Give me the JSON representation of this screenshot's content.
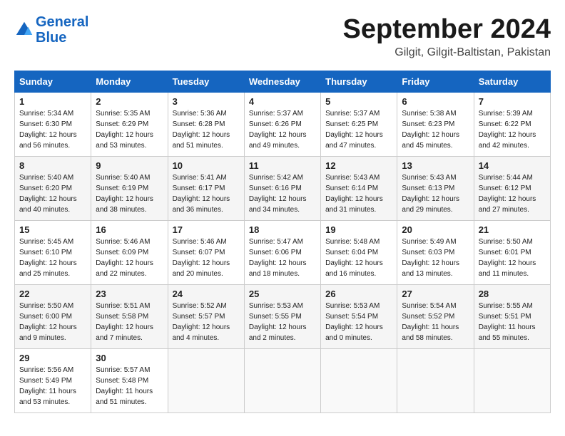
{
  "header": {
    "logo_line1": "General",
    "logo_line2": "Blue",
    "month": "September 2024",
    "location": "Gilgit, Gilgit-Baltistan, Pakistan"
  },
  "days_of_week": [
    "Sunday",
    "Monday",
    "Tuesday",
    "Wednesday",
    "Thursday",
    "Friday",
    "Saturday"
  ],
  "weeks": [
    [
      {
        "day": "1",
        "info": "Sunrise: 5:34 AM\nSunset: 6:30 PM\nDaylight: 12 hours\nand 56 minutes."
      },
      {
        "day": "2",
        "info": "Sunrise: 5:35 AM\nSunset: 6:29 PM\nDaylight: 12 hours\nand 53 minutes."
      },
      {
        "day": "3",
        "info": "Sunrise: 5:36 AM\nSunset: 6:28 PM\nDaylight: 12 hours\nand 51 minutes."
      },
      {
        "day": "4",
        "info": "Sunrise: 5:37 AM\nSunset: 6:26 PM\nDaylight: 12 hours\nand 49 minutes."
      },
      {
        "day": "5",
        "info": "Sunrise: 5:37 AM\nSunset: 6:25 PM\nDaylight: 12 hours\nand 47 minutes."
      },
      {
        "day": "6",
        "info": "Sunrise: 5:38 AM\nSunset: 6:23 PM\nDaylight: 12 hours\nand 45 minutes."
      },
      {
        "day": "7",
        "info": "Sunrise: 5:39 AM\nSunset: 6:22 PM\nDaylight: 12 hours\nand 42 minutes."
      }
    ],
    [
      {
        "day": "8",
        "info": "Sunrise: 5:40 AM\nSunset: 6:20 PM\nDaylight: 12 hours\nand 40 minutes."
      },
      {
        "day": "9",
        "info": "Sunrise: 5:40 AM\nSunset: 6:19 PM\nDaylight: 12 hours\nand 38 minutes."
      },
      {
        "day": "10",
        "info": "Sunrise: 5:41 AM\nSunset: 6:17 PM\nDaylight: 12 hours\nand 36 minutes."
      },
      {
        "day": "11",
        "info": "Sunrise: 5:42 AM\nSunset: 6:16 PM\nDaylight: 12 hours\nand 34 minutes."
      },
      {
        "day": "12",
        "info": "Sunrise: 5:43 AM\nSunset: 6:14 PM\nDaylight: 12 hours\nand 31 minutes."
      },
      {
        "day": "13",
        "info": "Sunrise: 5:43 AM\nSunset: 6:13 PM\nDaylight: 12 hours\nand 29 minutes."
      },
      {
        "day": "14",
        "info": "Sunrise: 5:44 AM\nSunset: 6:12 PM\nDaylight: 12 hours\nand 27 minutes."
      }
    ],
    [
      {
        "day": "15",
        "info": "Sunrise: 5:45 AM\nSunset: 6:10 PM\nDaylight: 12 hours\nand 25 minutes."
      },
      {
        "day": "16",
        "info": "Sunrise: 5:46 AM\nSunset: 6:09 PM\nDaylight: 12 hours\nand 22 minutes."
      },
      {
        "day": "17",
        "info": "Sunrise: 5:46 AM\nSunset: 6:07 PM\nDaylight: 12 hours\nand 20 minutes."
      },
      {
        "day": "18",
        "info": "Sunrise: 5:47 AM\nSunset: 6:06 PM\nDaylight: 12 hours\nand 18 minutes."
      },
      {
        "day": "19",
        "info": "Sunrise: 5:48 AM\nSunset: 6:04 PM\nDaylight: 12 hours\nand 16 minutes."
      },
      {
        "day": "20",
        "info": "Sunrise: 5:49 AM\nSunset: 6:03 PM\nDaylight: 12 hours\nand 13 minutes."
      },
      {
        "day": "21",
        "info": "Sunrise: 5:50 AM\nSunset: 6:01 PM\nDaylight: 12 hours\nand 11 minutes."
      }
    ],
    [
      {
        "day": "22",
        "info": "Sunrise: 5:50 AM\nSunset: 6:00 PM\nDaylight: 12 hours\nand 9 minutes."
      },
      {
        "day": "23",
        "info": "Sunrise: 5:51 AM\nSunset: 5:58 PM\nDaylight: 12 hours\nand 7 minutes."
      },
      {
        "day": "24",
        "info": "Sunrise: 5:52 AM\nSunset: 5:57 PM\nDaylight: 12 hours\nand 4 minutes."
      },
      {
        "day": "25",
        "info": "Sunrise: 5:53 AM\nSunset: 5:55 PM\nDaylight: 12 hours\nand 2 minutes."
      },
      {
        "day": "26",
        "info": "Sunrise: 5:53 AM\nSunset: 5:54 PM\nDaylight: 12 hours\nand 0 minutes."
      },
      {
        "day": "27",
        "info": "Sunrise: 5:54 AM\nSunset: 5:52 PM\nDaylight: 11 hours\nand 58 minutes."
      },
      {
        "day": "28",
        "info": "Sunrise: 5:55 AM\nSunset: 5:51 PM\nDaylight: 11 hours\nand 55 minutes."
      }
    ],
    [
      {
        "day": "29",
        "info": "Sunrise: 5:56 AM\nSunset: 5:49 PM\nDaylight: 11 hours\nand 53 minutes."
      },
      {
        "day": "30",
        "info": "Sunrise: 5:57 AM\nSunset: 5:48 PM\nDaylight: 11 hours\nand 51 minutes."
      },
      {
        "day": "",
        "info": ""
      },
      {
        "day": "",
        "info": ""
      },
      {
        "day": "",
        "info": ""
      },
      {
        "day": "",
        "info": ""
      },
      {
        "day": "",
        "info": ""
      }
    ]
  ]
}
